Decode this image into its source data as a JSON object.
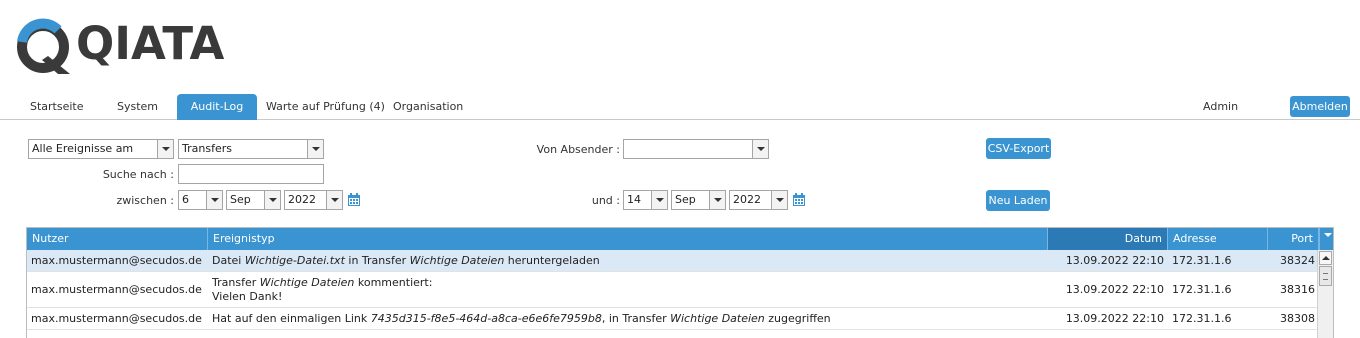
{
  "brand": {
    "logo_text": "QIATA",
    "logo_color": "#3b94d2",
    "text_color": "#3a3a3a"
  },
  "nav": {
    "items": [
      {
        "label": "Startseite"
      },
      {
        "label": "System"
      },
      {
        "label": "Audit-Log",
        "active": true
      },
      {
        "label": "Warte auf Prüfung (4)"
      },
      {
        "label": "Organisation"
      }
    ],
    "user": "Admin",
    "logout_label": "Abmelden"
  },
  "filters": {
    "event_scope": "Alle Ereignisse am",
    "event_type": "Transfers",
    "sender_label": "Von Absender :",
    "sender_value": "",
    "search_label": "Suche nach :",
    "search_value": "",
    "between_label": "zwischen :",
    "from_day": "6",
    "from_month": "Sep",
    "from_year": "2022",
    "and_label": "und :",
    "to_day": "14",
    "to_month": "Sep",
    "to_year": "2022",
    "csv_label": "CSV-Export",
    "reload_label": "Neu Laden",
    "calendar_icon": "calendar-icon"
  },
  "grid": {
    "columns": {
      "user": "Nutzer",
      "event": "Ereignistyp",
      "date": "Datum",
      "address": "Adresse",
      "port": "Port"
    },
    "rows": [
      {
        "user": "max.mustermann@secudos.de",
        "event_a": "Datei ",
        "event_b": "Wichtige-Datei.txt",
        "event_c": " in Transfer ",
        "event_d": "Wichtige Dateien",
        "event_e": " heruntergeladen",
        "date": "13.09.2022 22:10",
        "address": "172.31.1.6",
        "port": "38324"
      },
      {
        "user": "max.mustermann@secudos.de",
        "event_a": "Transfer ",
        "event_b": "Wichtige Dateien",
        "event_c": " kommentiert:",
        "event_line2": "Vielen Dank!",
        "date": "13.09.2022 22:10",
        "address": "172.31.1.6",
        "port": "38316"
      },
      {
        "user": "max.mustermann@secudos.de",
        "event_a": "Hat auf den einmaligen Link ",
        "event_b": "7435d315-f8e5-464d-a8ca-e6e6fe7959b8",
        "event_c": ", in Transfer ",
        "event_d": "Wichtige Dateien",
        "event_e": " zugegriffen",
        "date": "13.09.2022 22:10",
        "address": "172.31.1.6",
        "port": "38308"
      }
    ]
  }
}
